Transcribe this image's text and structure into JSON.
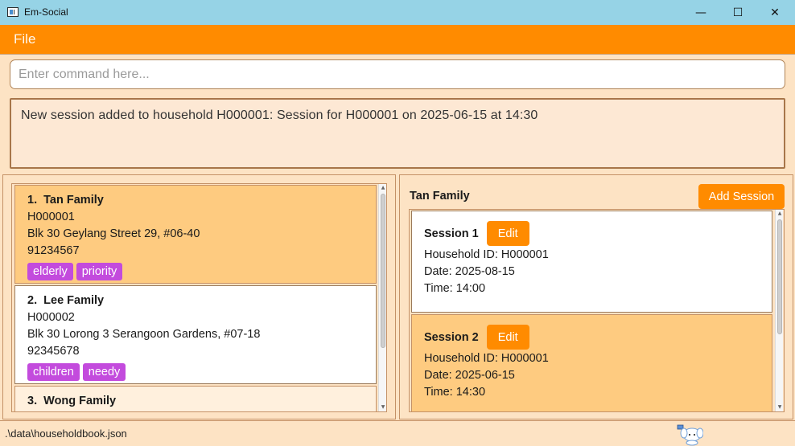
{
  "window": {
    "title": "Em-Social",
    "minimize_glyph": "—",
    "maximize_glyph": "☐",
    "close_glyph": "✕"
  },
  "menu": {
    "file_label": "File"
  },
  "command": {
    "placeholder": "Enter command here...",
    "value": ""
  },
  "result": {
    "message": "New session added to household H000001: Session for H000001 on 2025-06-15 at 14:30"
  },
  "households": [
    {
      "index": "1.",
      "name": "Tan Family",
      "id": "H000001",
      "address": "Blk 30 Geylang Street 29, #06-40",
      "phone": "91234567",
      "tags": [
        "elderly",
        "priority"
      ]
    },
    {
      "index": "2.",
      "name": "Lee Family",
      "id": "H000002",
      "address": "Blk 30 Lorong 3 Serangoon Gardens, #07-18",
      "phone": "92345678",
      "tags": [
        "children",
        "needy"
      ]
    },
    {
      "index": "3.",
      "name": "Wong Family"
    }
  ],
  "detail": {
    "title": "Tan Family",
    "add_session_label": "Add Session",
    "edit_label": "Edit",
    "sessions": [
      {
        "label": "Session 1",
        "household": "Household ID: H000001",
        "date": "Date: 2025-08-15",
        "time": "Time: 14:00"
      },
      {
        "label": "Session 2",
        "household": "Household ID: H000001",
        "date": "Date: 2025-06-15",
        "time": "Time: 14:30"
      }
    ]
  },
  "status": {
    "path": ".\\data\\householdbook.json"
  },
  "colors": {
    "accent": "#ff8b00",
    "titlebar": "#96d3e6",
    "tag": "#c34bdd",
    "selected": "#fecb80",
    "background": "#fde3c4"
  }
}
